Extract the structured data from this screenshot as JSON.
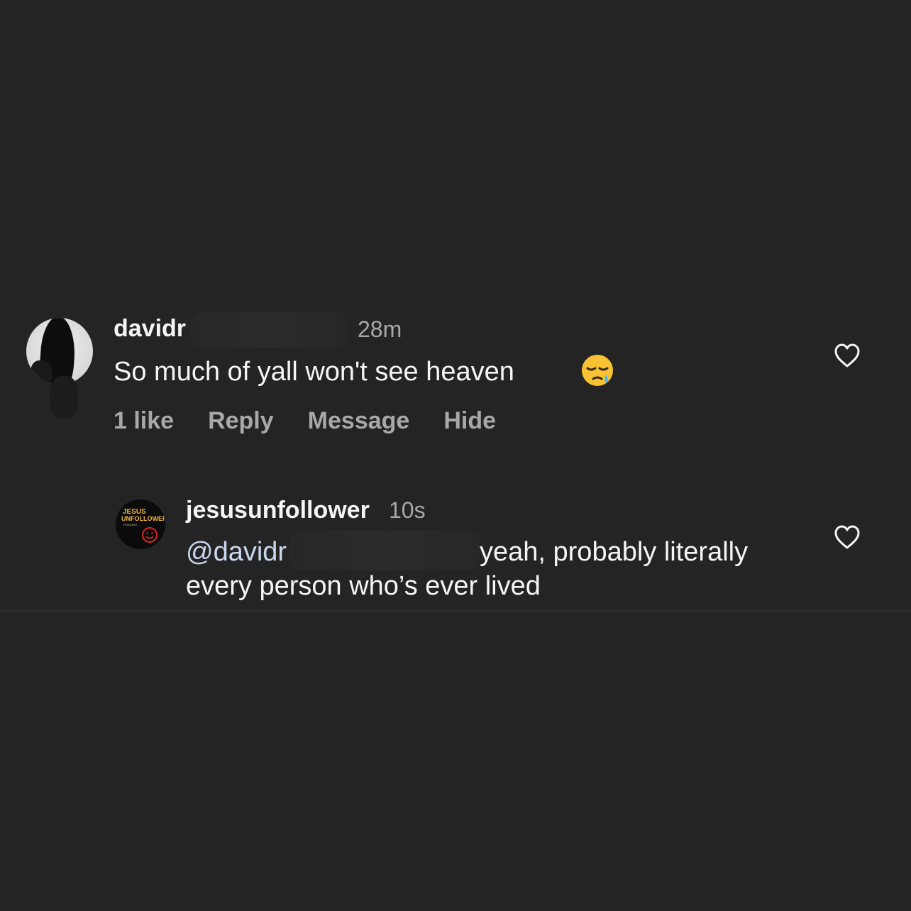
{
  "comment": {
    "username": "davidr",
    "time": "28m",
    "text": "So much of yall won't see heaven",
    "emoji_icon": "sleepy-face-icon",
    "actions": {
      "likes": "1 like",
      "reply": "Reply",
      "message": "Message",
      "hide": "Hide"
    }
  },
  "reply": {
    "username": "jesusunfollower",
    "time": "10s",
    "mention": "@davidr",
    "text_line1": "yeah, probably literally",
    "text_line2": "every person who’s ever lived",
    "avatar_logo": {
      "line1": "JESUS",
      "line2": "UNFOLLOWER",
      "line3": "PODCAST"
    }
  },
  "colors": {
    "background": "#242424",
    "primary_text": "#f5f5f5",
    "secondary_text": "#a8a8a8",
    "mention": "#c9d8ef",
    "logo_yellow": "#f0b43a",
    "logo_red": "#d8262b"
  }
}
